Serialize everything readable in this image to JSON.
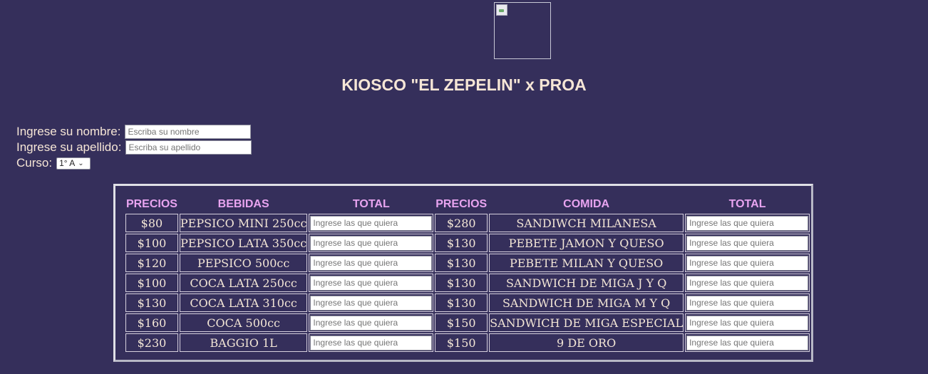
{
  "title": "KIOSCO \"EL ZEPELIN\" x PROA",
  "form": {
    "nombre_label": "Ingrese su nombre:",
    "nombre_placeholder": "Escriba su nombre",
    "apellido_label": "Ingrese su apellido:",
    "apellido_placeholder": "Escriba su apellido",
    "curso_label": "Curso:",
    "curso_value": "1° A"
  },
  "table": {
    "headers": [
      "PRECIOS",
      "BEBIDAS",
      "TOTAL",
      "PRECIOS",
      "COMIDA",
      "TOTAL"
    ],
    "input_placeholder": "Ingrese las que quiera",
    "rows": [
      {
        "bebida_precio": "$80",
        "bebida": "PEPSICO MINI 250cc",
        "comida_precio": "$280",
        "comida": "SANDIWCH MILANESA"
      },
      {
        "bebida_precio": "$100",
        "bebida": "PEPSICO LATA 350cc",
        "comida_precio": "$130",
        "comida": "PEBETE JAMON Y QUESO"
      },
      {
        "bebida_precio": "$120",
        "bebida": "PEPSICO 500cc",
        "comida_precio": "$130",
        "comida": "PEBETE MILAN Y QUESO"
      },
      {
        "bebida_precio": "$100",
        "bebida": "COCA LATA 250cc",
        "comida_precio": "$130",
        "comida": "SANDWICH DE MIGA J Y Q"
      },
      {
        "bebida_precio": "$130",
        "bebida": "COCA LATA 310cc",
        "comida_precio": "$130",
        "comida": "SANDWICH DE MIGA M Y Q"
      },
      {
        "bebida_precio": "$160",
        "bebida": "COCA 500cc",
        "comida_precio": "$150",
        "comida": "SANDWICH DE MIGA ESPECIAL"
      },
      {
        "bebida_precio": "$230",
        "bebida": "BAGGIO 1L",
        "comida_precio": "$150",
        "comida": "9 DE ORO"
      }
    ]
  },
  "colors": {
    "background": "#352f5b",
    "header_text": "#e8a4f0",
    "body_text": "#f3e6d6"
  },
  "icons": {
    "logo": "broken-image-icon"
  }
}
